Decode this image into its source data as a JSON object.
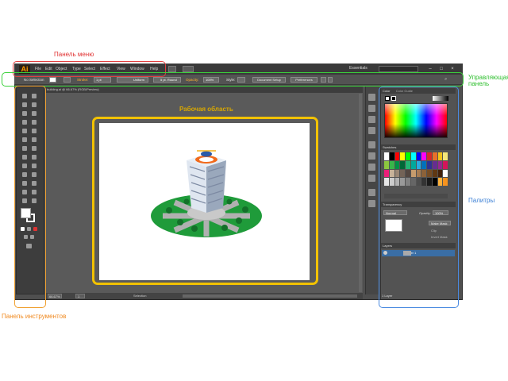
{
  "annotations": {
    "menu_bar": "Панель меню",
    "control_panel_line1": "Управляющая",
    "control_panel_line2": "панель",
    "workspace": "Рабочая область",
    "palettes": "Палитры",
    "tools_panel": "Панель инструментов"
  },
  "app": {
    "logo": "Ai",
    "menu": [
      "File",
      "Edit",
      "Object",
      "Type",
      "Select",
      "Effect",
      "View",
      "Window",
      "Help"
    ],
    "workspace_switcher": "Essentials",
    "window_controls": [
      "–",
      "□",
      "×"
    ]
  },
  "control_bar": {
    "selection": "No Selection",
    "stroke_label": "Stroke:",
    "stroke_value": "1 pt",
    "stroke_profile": "Uniform",
    "brush": "5 pt. Round",
    "opacity_label": "Opacity:",
    "opacity_value": "100%",
    "style_label": "Style:",
    "document_setup": "Document Setup",
    "preferences": "Preferences"
  },
  "document": {
    "tab_title": "building.ai @ 66.67% (RGB/Preview)",
    "zoom": "66.67%",
    "page": "1",
    "status": "Selection"
  },
  "panels": {
    "color_tab": "Color",
    "color_guide_tab": "Color Guide",
    "swatches_tab": "Swatches",
    "transparency_tab": "Transparency",
    "blend_mode": "Normal",
    "opacity_label": "Opacity:",
    "opacity_value": "100%",
    "make_mask": "Make Mask",
    "clip": "Clip",
    "invert_mask": "Invert Mask",
    "layers_tab": "Layers",
    "layer_name": "Layer 1",
    "layers_count": "1 Layer"
  },
  "colors": {
    "menu_annotation": "#e04040",
    "control_annotation": "#3bd13b",
    "tools_annotation": "#f0a030",
    "workspace_annotation": "#f2c200",
    "palettes_annotation": "#4a8ae0",
    "accent": "#ff9a00"
  }
}
